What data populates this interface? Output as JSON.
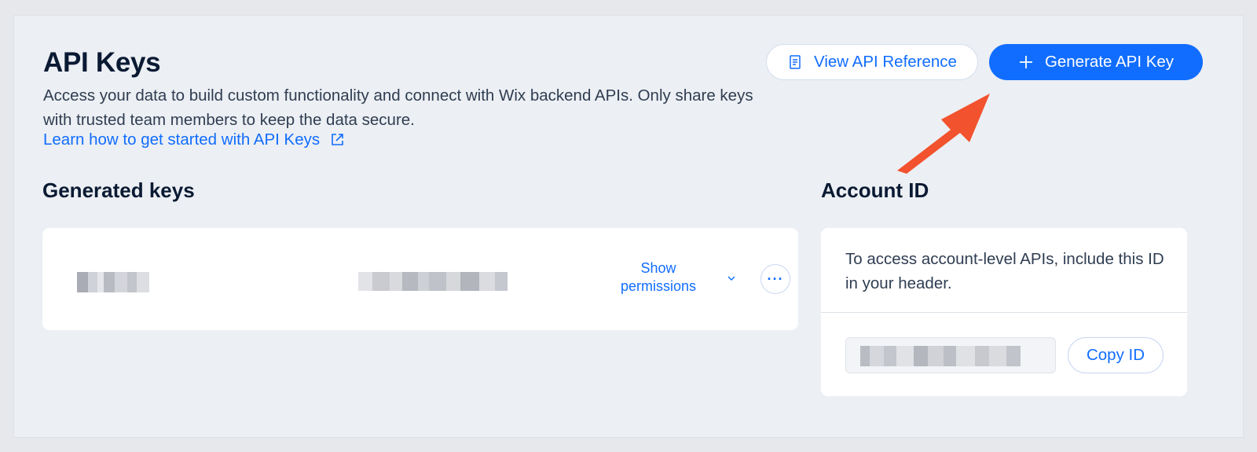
{
  "header": {
    "title": "API Keys",
    "description": "Access your data to build custom functionality and connect with Wix backend APIs. Only share keys with trusted team members to keep the data secure.",
    "learn_link": "Learn how to get started with API Keys"
  },
  "actions": {
    "view_reference_label": "View API Reference",
    "generate_label": "Generate API Key"
  },
  "generated_keys": {
    "title": "Generated keys",
    "rows": [
      {
        "show_permissions_label": "Show permissions"
      }
    ]
  },
  "account": {
    "title": "Account ID",
    "description": "To access account-level APIs, include this ID in your header.",
    "copy_label": "Copy ID"
  },
  "colors": {
    "accent": "#116dff",
    "annotation_arrow": "#f2522e",
    "background": "#eceff3"
  },
  "icons": [
    "document-icon",
    "plus-icon",
    "external-link-icon",
    "chevron-down-icon",
    "more-icon",
    "arrow-annotation"
  ]
}
